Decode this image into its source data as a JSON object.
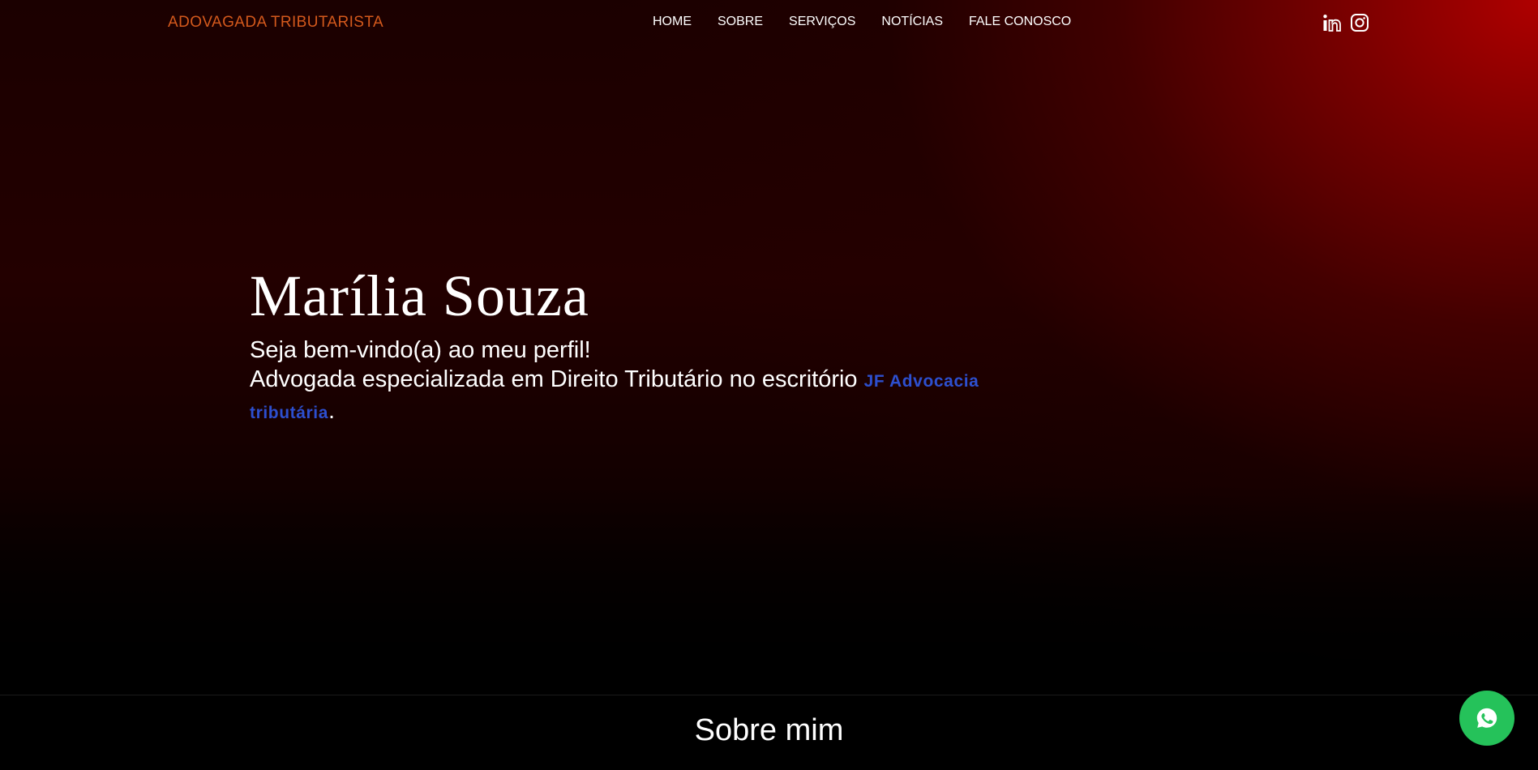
{
  "navbar": {
    "brand": "ADOVAGADA TRIBUTARISTA",
    "links": [
      "HOME",
      "SOBRE",
      "SERVIÇOS",
      "NOTÍCIAS",
      "FALE CONOSCO"
    ],
    "social_icons": [
      "linkedin-icon",
      "instagram-icon"
    ]
  },
  "hero": {
    "title": "Marília Souza",
    "welcome": "Seja bem-vindo(a) ao meu perfil!",
    "description": "Advogada especializada em Direito Tributário no escritório ",
    "firm_link": "JF Advocacia tributária",
    "period": "."
  },
  "about": {
    "title": "Sobre mim"
  },
  "floating": {
    "icon": "whatsapp-icon"
  },
  "colors": {
    "brand": "#d4591c",
    "link": "#2d4fcf",
    "whatsapp": "#25c25a",
    "hero_red": "#af0000"
  }
}
